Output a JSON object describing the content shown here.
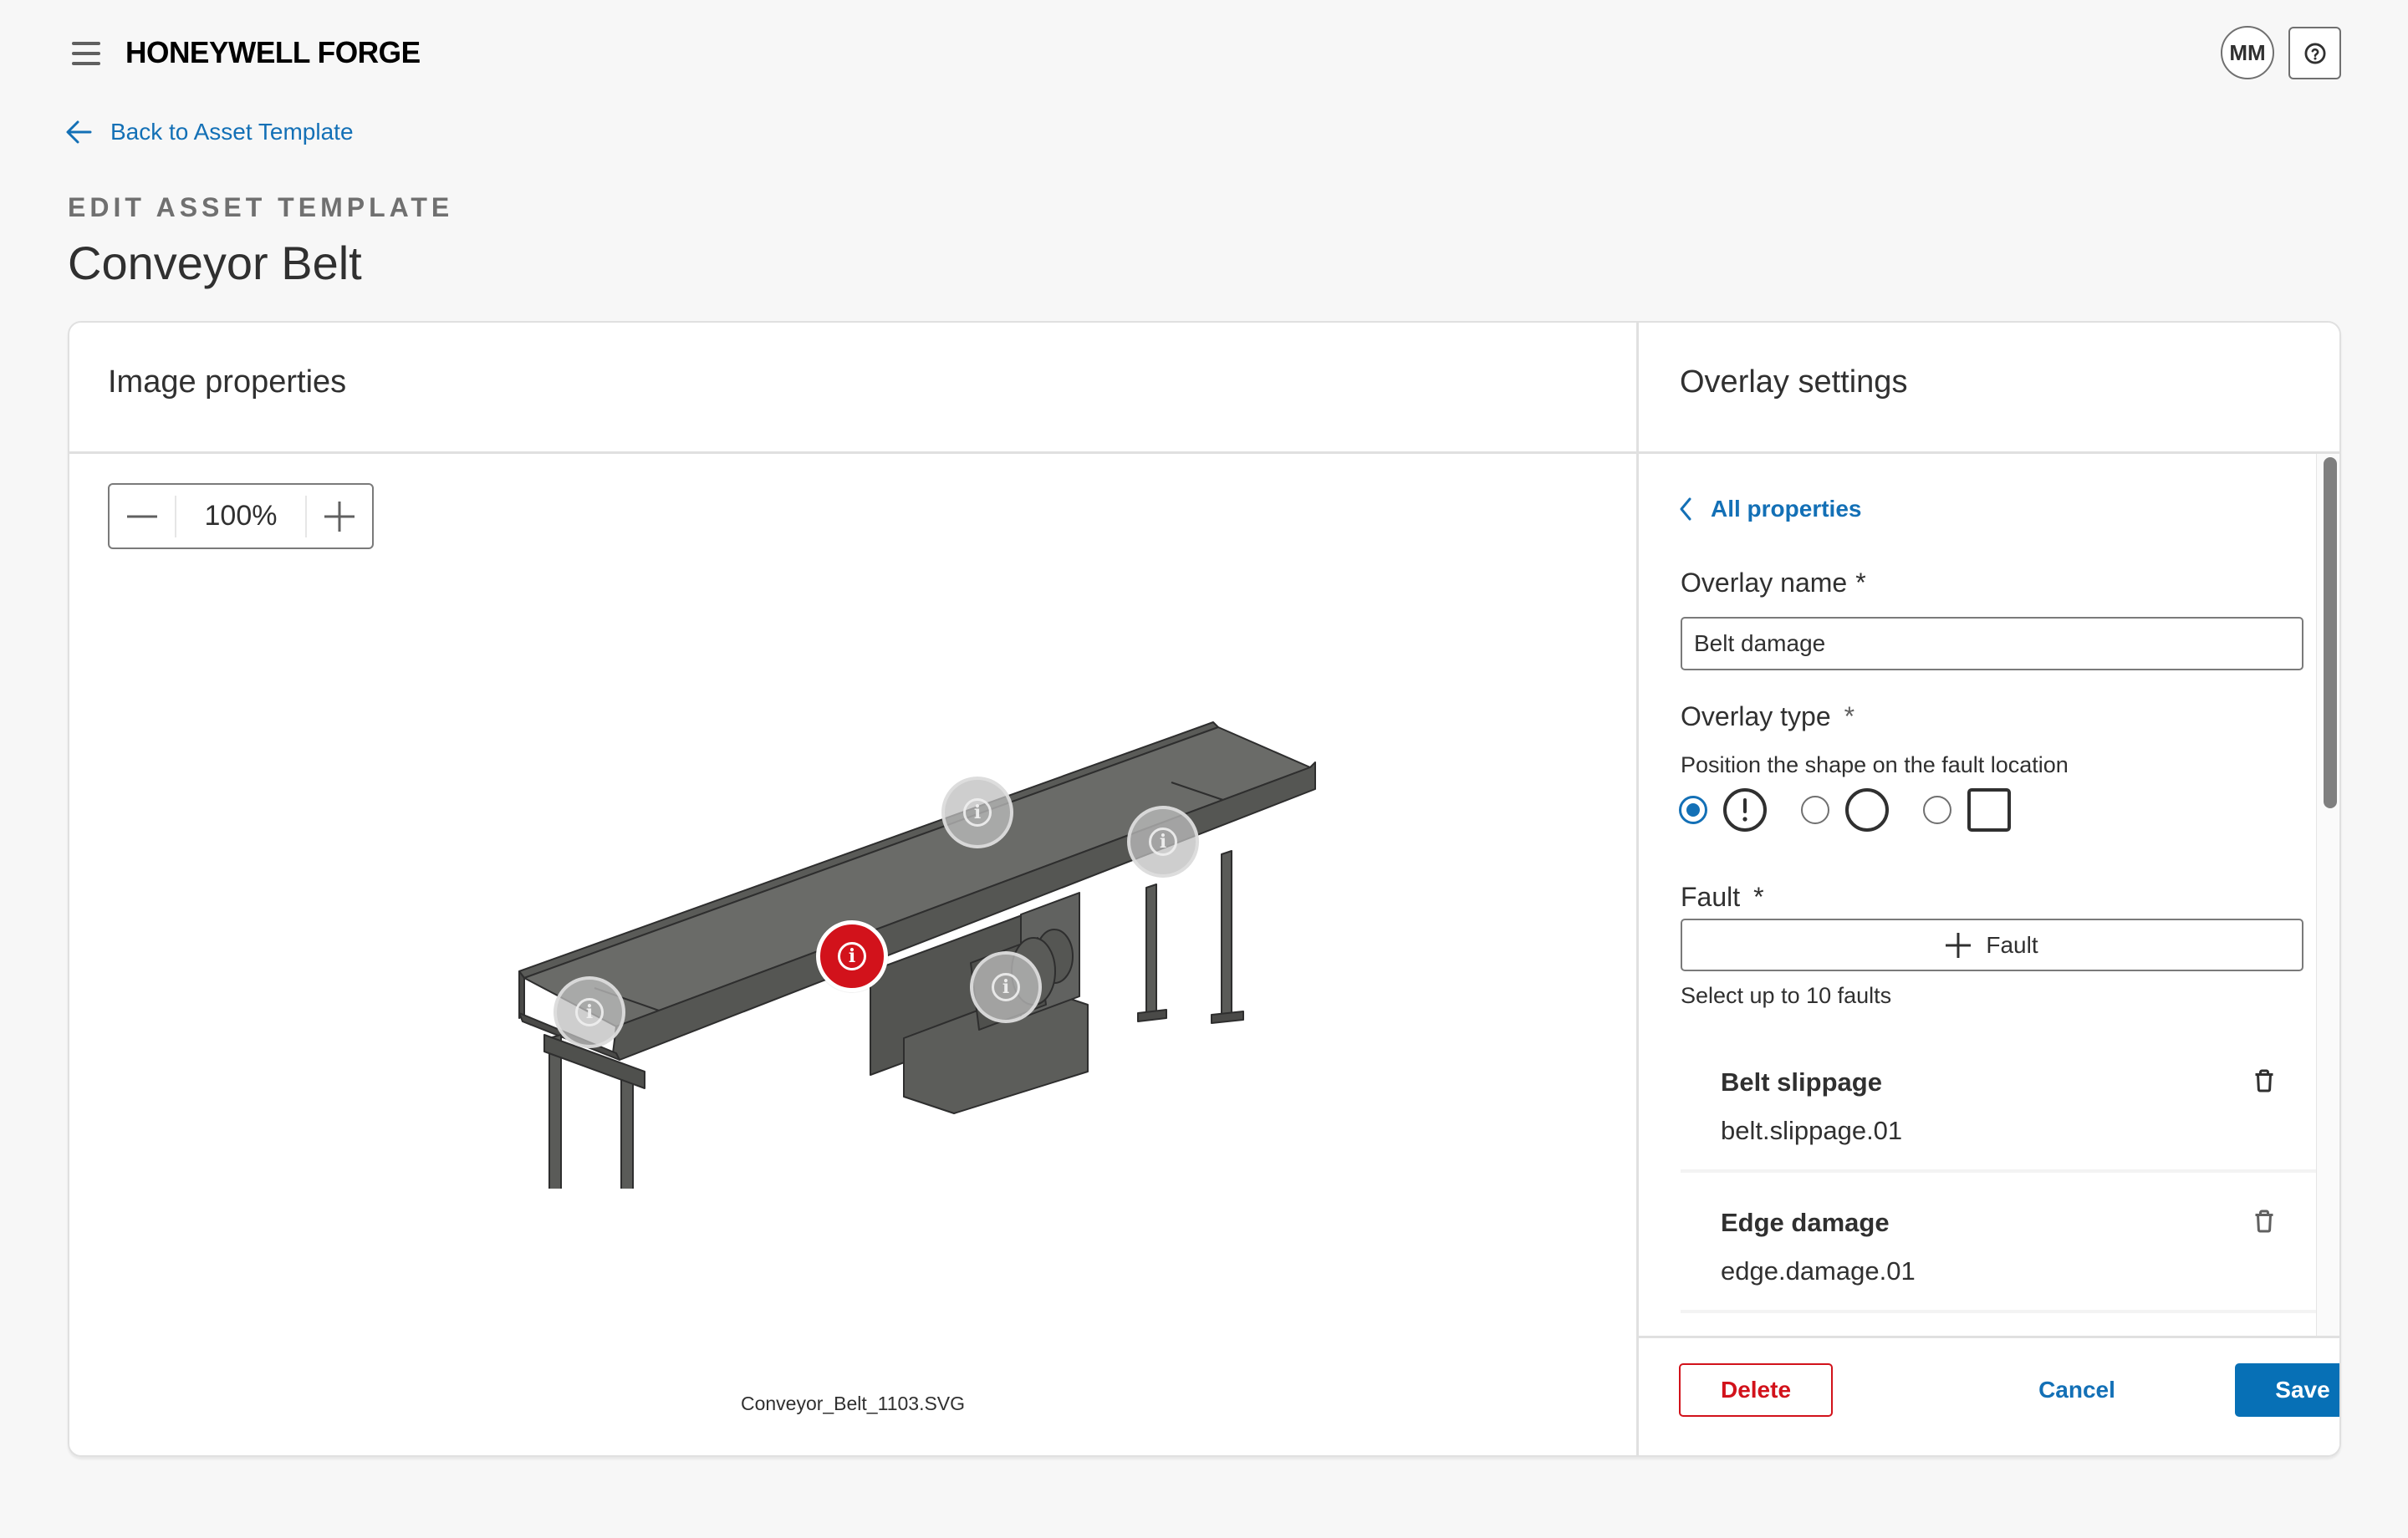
{
  "app": {
    "brand": "HONEYWELL FORGE",
    "user_initials": "MM",
    "menu_icon": "hamburger-icon",
    "help_icon": "help-circle-icon"
  },
  "nav": {
    "back_label": "Back to Asset Template",
    "back_icon": "arrow-left-icon"
  },
  "page": {
    "eyebrow": "EDIT ASSET TEMPLATE",
    "title": "Conveyor Belt"
  },
  "image_panel": {
    "title": "Image properties",
    "zoom_level": "100%",
    "zoom_out_icon": "minus-icon",
    "zoom_in_icon": "plus-icon",
    "file_name": "Conveyor_Belt_1103.SVG",
    "markers": [
      {
        "name": "marker-top-center",
        "state": "inactive",
        "icon": "info-icon"
      },
      {
        "name": "marker-top-right",
        "state": "inactive",
        "icon": "info-icon"
      },
      {
        "name": "marker-motor",
        "state": "active",
        "icon": "info-icon"
      },
      {
        "name": "marker-gearbox",
        "state": "inactive",
        "icon": "info-icon"
      },
      {
        "name": "marker-left-end",
        "state": "inactive",
        "icon": "info-icon"
      }
    ],
    "colors": {
      "active_marker": "#d2121b",
      "machine": "#5a5b58"
    }
  },
  "overlay_panel": {
    "title": "Overlay settings",
    "all_properties_label": "All properties",
    "overlay_name_label": "Overlay name",
    "required_mark": "*",
    "overlay_name_value": "Belt damage",
    "overlay_type_label": "Overlay type",
    "overlay_type_helper": "Position the shape on the fault location",
    "overlay_types": [
      {
        "id": "alert-circle",
        "icon": "alert-circle-icon",
        "selected": true
      },
      {
        "id": "circle",
        "icon": "circle-icon",
        "selected": false
      },
      {
        "id": "square",
        "icon": "square-icon",
        "selected": false
      }
    ],
    "fault_label": "Fault",
    "add_fault_label": "Fault",
    "fault_helper": "Select up to 10 faults",
    "faults": [
      {
        "title": "Belt slippage",
        "code": "belt.slippage.01"
      },
      {
        "title": "Edge damage",
        "code": "edge.damage.01"
      }
    ],
    "scroll_position": 0.0
  },
  "footer": {
    "delete_label": "Delete",
    "cancel_label": "Cancel",
    "save_label": "Save"
  },
  "colors": {
    "accent": "#1370b6",
    "primary_button": "#0770b6",
    "danger": "#d2121b",
    "background": "#f7f7f7",
    "text": "#303030"
  }
}
